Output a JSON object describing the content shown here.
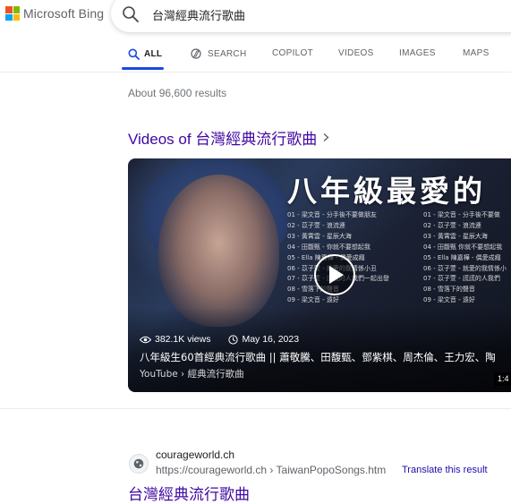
{
  "header": {
    "logo_text": "Microsoft Bing",
    "search_value": "台灣經典流行歌曲"
  },
  "tabs": [
    {
      "label": "ALL",
      "active": true,
      "icon": "search-icon"
    },
    {
      "label": "SEARCH",
      "active": false,
      "icon": "copilot-search-icon"
    },
    {
      "label": "COPILOT",
      "active": false
    },
    {
      "label": "VIDEOS",
      "active": false
    },
    {
      "label": "IMAGES",
      "active": false
    },
    {
      "label": "MAPS",
      "active": false
    }
  ],
  "results_count": "About 96,600 results",
  "videos_section": {
    "heading": "Videos of 台灣經典流行歌曲"
  },
  "video": {
    "thumbnail_title": "八年級最愛的",
    "playlist_left": [
      "01 - 梁文音 - 分手後不要做朋友",
      "02 - 苡子萱 - 浪流連",
      "03 - 黃霄雲 - 星辰大海",
      "04 - 田馥甄 - 你就不要想起我",
      "05 - Ella 陳嘉樺 - 偶愛成癮",
      "06 - 苡子萱 - 就愛的我情係小丑",
      "07 - 苡子萱 - 謊謊的人我們一起出發",
      "08 - 雪落下的聲音",
      "09 - 梁文音 - 遠好"
    ],
    "playlist_right": [
      "01 - 梁文音 - 分手後不要做",
      "02 - 苡子萱 - 浪流連",
      "03 - 黃霄雲 - 星辰大海",
      "04 - 田馥甄 你就不要想起我",
      "05 - Ella 陳嘉樺 - 偶愛成癮",
      "06 - 苡子萱 - 就愛的我情係小",
      "07 - 苡子萱 - 謊謊的人我們",
      "08 - 雪落下的聲音",
      "09 - 梁文音 - 遠好"
    ],
    "views": "382.1K views",
    "date": "May 16, 2023",
    "title": "八年級生60首經典流行歌曲 || 蕭敬騰、田馥甄、鄧紫棋、周杰倫、王力宏、陶",
    "source": "YouTube › 經典流行歌曲",
    "duration": "1:4"
  },
  "web_result": {
    "site_name": "courageworld.ch",
    "url": "https://courageworld.ch › TaiwanPopoSongs.htm",
    "translate_label": "Translate this result",
    "title": "台灣經典流行歌曲"
  },
  "colors": {
    "bing_blue": "#174ae4",
    "visited_link": "#4007a2",
    "logo_red": "#f25022",
    "logo_green": "#7fba00",
    "logo_blue": "#00a4ef",
    "logo_yellow": "#ffb900"
  }
}
